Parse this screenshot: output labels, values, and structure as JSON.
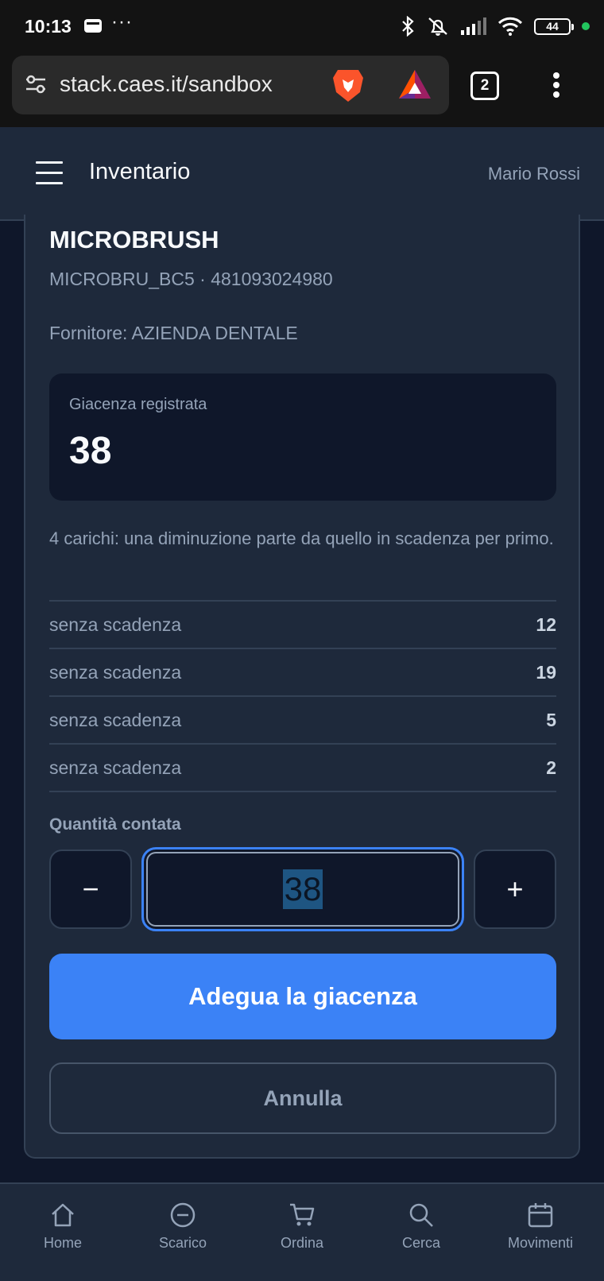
{
  "status_bar": {
    "time": "10:13",
    "more": "···",
    "battery": "44"
  },
  "browser": {
    "url": "stack.caes.it/sandbox",
    "tab_count": "2"
  },
  "header": {
    "title": "Inventario",
    "user": "Mario Rossi"
  },
  "product": {
    "name": "MICROBRUSH",
    "code": "MICROBRU_BC5 · 481093024980",
    "supplier": "Fornitore: AZIENDA DENTALE"
  },
  "stock": {
    "label": "Giacenza registrata",
    "value": "38"
  },
  "lots": {
    "description": "4 carichi: una diminuzione parte da quello in scadenza per primo.",
    "rows": [
      {
        "label": "senza scadenza",
        "qty": "12"
      },
      {
        "label": "senza scadenza",
        "qty": "19"
      },
      {
        "label": "senza scadenza",
        "qty": "5"
      },
      {
        "label": "senza scadenza",
        "qty": "2"
      }
    ]
  },
  "quantity": {
    "label": "Quantità contata",
    "minus": "−",
    "value": "38",
    "plus": "+"
  },
  "actions": {
    "adjust": "Adegua la giacenza",
    "cancel": "Annulla"
  },
  "nav": [
    {
      "label": "Home",
      "icon": "home-icon"
    },
    {
      "label": "Scarico",
      "icon": "minus-circle-icon"
    },
    {
      "label": "Ordina",
      "icon": "cart-icon"
    },
    {
      "label": "Cerca",
      "icon": "search-icon"
    },
    {
      "label": "Movimenti",
      "icon": "calendar-icon"
    }
  ],
  "colors": {
    "accent": "#3b82f6",
    "background": "#0f172a",
    "surface": "#1e293b",
    "border": "#334155",
    "muted": "#94a3b8"
  }
}
